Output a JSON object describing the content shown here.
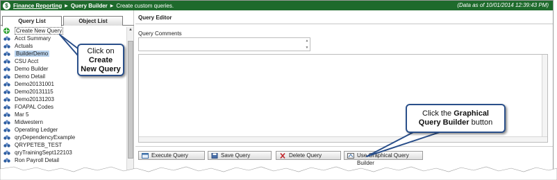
{
  "topbar": {
    "crumb_link": "Finance Reporting",
    "crumb_current": "Query Builder",
    "subtitle": "Create custom queries.",
    "as_of": "(Data as of 10/01/2014 12:39:43 PM)"
  },
  "tabs": [
    {
      "label": "Query List",
      "active": true
    },
    {
      "label": "Object List",
      "active": false
    }
  ],
  "queries": [
    {
      "label": "Create New Query",
      "icon": "plus-icon"
    },
    {
      "label": "Acct Summary",
      "icon": "binoculars-icon"
    },
    {
      "label": "Actuals",
      "icon": "binoculars-icon"
    },
    {
      "label": "BuilderDemo",
      "icon": "binoculars-icon"
    },
    {
      "label": "CSU Acct",
      "icon": "binoculars-icon"
    },
    {
      "label": "Demo Builder",
      "icon": "binoculars-icon"
    },
    {
      "label": "Demo Detail",
      "icon": "binoculars-icon"
    },
    {
      "label": "Demo20131001",
      "icon": "binoculars-icon"
    },
    {
      "label": "Demo20131115",
      "icon": "binoculars-icon"
    },
    {
      "label": "Demo20131203",
      "icon": "binoculars-icon"
    },
    {
      "label": "FOAPAL Codes",
      "icon": "binoculars-icon"
    },
    {
      "label": "Mar 5",
      "icon": "binoculars-icon"
    },
    {
      "label": "Midwestern",
      "icon": "binoculars-icon"
    },
    {
      "label": "Operating Ledger",
      "icon": "binoculars-icon"
    },
    {
      "label": "qryDependencyExample",
      "icon": "binoculars-icon"
    },
    {
      "label": "QRYPETEB_TEST",
      "icon": "binoculars-icon"
    },
    {
      "label": "qryTrainingSept122103",
      "icon": "binoculars-icon"
    },
    {
      "label": "Ron Payroll Detail",
      "icon": "binoculars-icon"
    }
  ],
  "editor": {
    "title": "Query Editor",
    "comments_label": "Query Comments"
  },
  "buttons": {
    "execute": "Execute Query",
    "save": "Save Query",
    "delete": "Delete Query",
    "graphical": "Use Graphical Query Builder"
  },
  "callout_create": {
    "line1": "Click on",
    "line2": "Create",
    "line3": "New Query"
  },
  "callout_graphical": {
    "pre": "Click the ",
    "bold1": "Graphical",
    "bold2": "Query Builder",
    "post": " button"
  },
  "colors": {
    "topbar": "#1e6a2c",
    "selection": "#b9d3ee",
    "callout_border": "#2a4f8a"
  }
}
